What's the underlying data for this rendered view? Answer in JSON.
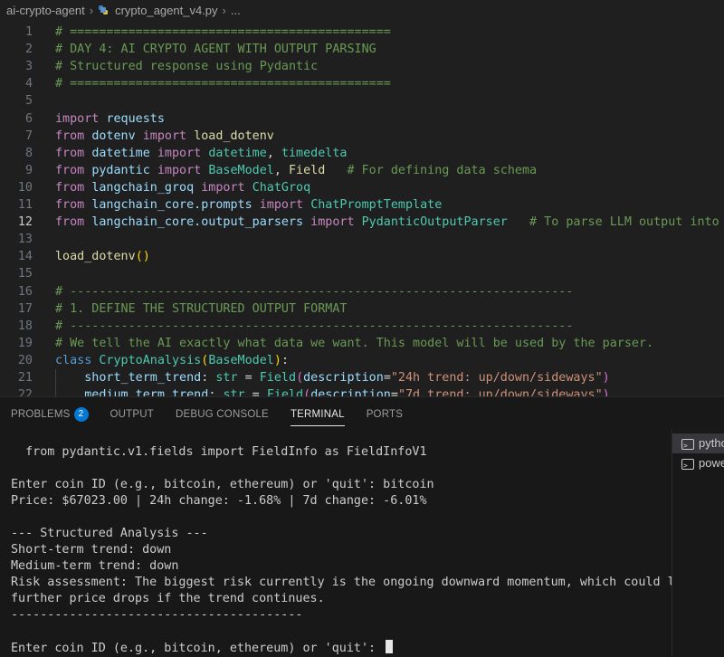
{
  "breadcrumb": {
    "folder": "ai-crypto-agent",
    "file": "crypto_agent_v4.py",
    "more": "..."
  },
  "editor": {
    "active_line": 12,
    "lines": [
      {
        "n": "1",
        "parts": [
          [
            "c-comment",
            "# ============================================"
          ]
        ]
      },
      {
        "n": "2",
        "parts": [
          [
            "c-comment",
            "# DAY 4: AI CRYPTO AGENT WITH OUTPUT PARSING"
          ]
        ]
      },
      {
        "n": "3",
        "parts": [
          [
            "c-comment",
            "# Structured response using Pydantic"
          ]
        ]
      },
      {
        "n": "4",
        "parts": [
          [
            "c-comment",
            "# ============================================"
          ]
        ]
      },
      {
        "n": "5",
        "parts": []
      },
      {
        "n": "6",
        "parts": [
          [
            "c-kw",
            "import"
          ],
          [
            "c-plain",
            " "
          ],
          [
            "c-var",
            "requests"
          ]
        ]
      },
      {
        "n": "7",
        "parts": [
          [
            "c-kw",
            "from"
          ],
          [
            "c-plain",
            " "
          ],
          [
            "c-var",
            "dotenv"
          ],
          [
            "c-plain",
            " "
          ],
          [
            "c-kw",
            "import"
          ],
          [
            "c-plain",
            " "
          ],
          [
            "c-fn",
            "load_dotenv"
          ]
        ]
      },
      {
        "n": "8",
        "parts": [
          [
            "c-kw",
            "from"
          ],
          [
            "c-plain",
            " "
          ],
          [
            "c-var",
            "datetime"
          ],
          [
            "c-plain",
            " "
          ],
          [
            "c-kw",
            "import"
          ],
          [
            "c-plain",
            " "
          ],
          [
            "c-cls",
            "datetime"
          ],
          [
            "c-plain",
            ", "
          ],
          [
            "c-cls",
            "timedelta"
          ]
        ]
      },
      {
        "n": "9",
        "parts": [
          [
            "c-kw",
            "from"
          ],
          [
            "c-plain",
            " "
          ],
          [
            "c-var",
            "pydantic"
          ],
          [
            "c-plain",
            " "
          ],
          [
            "c-kw",
            "import"
          ],
          [
            "c-plain",
            " "
          ],
          [
            "c-cls",
            "BaseModel"
          ],
          [
            "c-plain",
            ", "
          ],
          [
            "c-fn",
            "Field"
          ],
          [
            "c-plain",
            "   "
          ],
          [
            "c-comment",
            "# For defining data schema"
          ]
        ]
      },
      {
        "n": "10",
        "parts": [
          [
            "c-kw",
            "from"
          ],
          [
            "c-plain",
            " "
          ],
          [
            "c-var",
            "langchain_groq"
          ],
          [
            "c-plain",
            " "
          ],
          [
            "c-kw",
            "import"
          ],
          [
            "c-plain",
            " "
          ],
          [
            "c-cls",
            "ChatGroq"
          ]
        ]
      },
      {
        "n": "11",
        "parts": [
          [
            "c-kw",
            "from"
          ],
          [
            "c-plain",
            " "
          ],
          [
            "c-var",
            "langchain_core.prompts"
          ],
          [
            "c-plain",
            " "
          ],
          [
            "c-kw",
            "import"
          ],
          [
            "c-plain",
            " "
          ],
          [
            "c-cls",
            "ChatPromptTemplate"
          ]
        ]
      },
      {
        "n": "12",
        "parts": [
          [
            "c-kw",
            "from"
          ],
          [
            "c-plain",
            " "
          ],
          [
            "c-var",
            "langchain_core.output_parsers"
          ],
          [
            "c-plain",
            " "
          ],
          [
            "c-kw",
            "import"
          ],
          [
            "c-plain",
            " "
          ],
          [
            "c-cls",
            "PydanticOutputParser"
          ],
          [
            "c-plain",
            "   "
          ],
          [
            "c-comment",
            "# To parse LLM output into our"
          ]
        ]
      },
      {
        "n": "13",
        "parts": []
      },
      {
        "n": "14",
        "parts": [
          [
            "c-fn",
            "load_dotenv"
          ],
          [
            "c-paren",
            "()"
          ]
        ]
      },
      {
        "n": "15",
        "parts": []
      },
      {
        "n": "16",
        "parts": [
          [
            "c-comment",
            "# ---------------------------------------------------------------------"
          ]
        ]
      },
      {
        "n": "17",
        "parts": [
          [
            "c-comment",
            "# 1. DEFINE THE STRUCTURED OUTPUT FORMAT"
          ]
        ]
      },
      {
        "n": "18",
        "parts": [
          [
            "c-comment",
            "# ---------------------------------------------------------------------"
          ]
        ]
      },
      {
        "n": "19",
        "parts": [
          [
            "c-comment",
            "# We tell the AI exactly what data we want. This model will be used by the parser."
          ]
        ]
      },
      {
        "n": "20",
        "parts": [
          [
            "c-kw2",
            "class"
          ],
          [
            "c-plain",
            " "
          ],
          [
            "c-cls",
            "CryptoAnalysis"
          ],
          [
            "c-paren",
            "("
          ],
          [
            "c-cls",
            "BaseModel"
          ],
          [
            "c-paren",
            ")"
          ],
          [
            "c-plain",
            ":"
          ]
        ]
      },
      {
        "n": "21",
        "parts": [
          [
            "c-plain",
            "    "
          ],
          [
            "c-var",
            "short_term_trend"
          ],
          [
            "c-plain",
            ": "
          ],
          [
            "c-cls",
            "str"
          ],
          [
            "c-plain",
            " = "
          ],
          [
            "c-cls",
            "Field"
          ],
          [
            "c-paren2",
            "("
          ],
          [
            "c-var",
            "description"
          ],
          [
            "c-plain",
            "="
          ],
          [
            "c-str",
            "\"24h trend: up/down/sideways\""
          ],
          [
            "c-paren2",
            ")"
          ]
        ]
      },
      {
        "n": "22",
        "parts": [
          [
            "c-plain",
            "    "
          ],
          [
            "c-var",
            "medium_term_trend"
          ],
          [
            "c-plain",
            ": "
          ],
          [
            "c-cls",
            "str"
          ],
          [
            "c-plain",
            " = "
          ],
          [
            "c-cls",
            "Field"
          ],
          [
            "c-paren2",
            "("
          ],
          [
            "c-var",
            "description"
          ],
          [
            "c-plain",
            "="
          ],
          [
            "c-str",
            "\"7d trend: up/down/sideways\""
          ],
          [
            "c-paren2",
            ")"
          ]
        ]
      }
    ]
  },
  "panel": {
    "tabs": [
      {
        "label": "PROBLEMS",
        "badge": "2",
        "active": false
      },
      {
        "label": "OUTPUT",
        "active": false
      },
      {
        "label": "DEBUG CONSOLE",
        "active": false
      },
      {
        "label": "TERMINAL",
        "active": true
      },
      {
        "label": "PORTS",
        "active": false
      }
    ],
    "terminal_lines": [
      "  from pydantic.v1.fields import FieldInfo as FieldInfoV1",
      "",
      "Enter coin ID (e.g., bitcoin, ethereum) or 'quit': bitcoin",
      "Price: $67023.00 | 24h change: -1.68% | 7d change: -6.01%",
      "",
      "--- Structured Analysis ---",
      "Short-term trend: down",
      "Medium-term trend: down",
      "Risk assessment: The biggest risk currently is the ongoing downward momentum, which could lead to",
      "further price drops if the trend continues.",
      "----------------------------------------",
      "",
      "Enter coin ID (e.g., bitcoin, ethereum) or 'quit': "
    ],
    "terminals": [
      {
        "label": "python",
        "selected": true
      },
      {
        "label": "powershell",
        "selected": false
      }
    ]
  }
}
